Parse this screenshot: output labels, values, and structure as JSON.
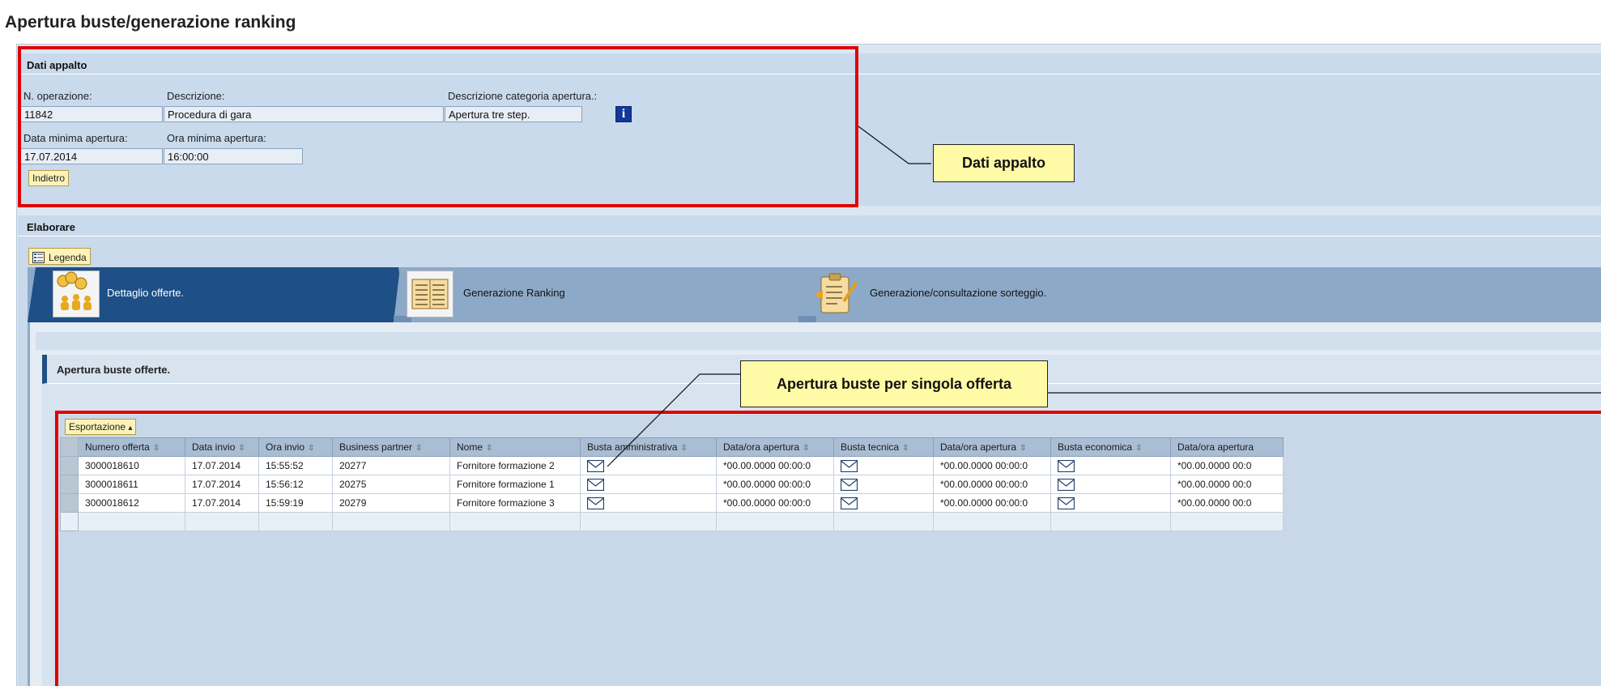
{
  "page_title": "Apertura buste/generazione ranking",
  "dati_appalto": {
    "header": "Dati appalto",
    "labels": {
      "n_operazione": "N. operazione:",
      "descrizione": "Descrizione:",
      "descrizione_categoria": "Descrizione categoria apertura.:",
      "data_minima": "Data minima apertura:",
      "ora_minima": "Ora minima apertura:"
    },
    "values": {
      "n_operazione": "11842",
      "descrizione": "Procedura di gara",
      "descrizione_categoria": "Apertura tre step.",
      "data_minima": "17.07.2014",
      "ora_minima": "16:00:00"
    },
    "info_icon": "i",
    "back_button": "Indietro"
  },
  "callouts": {
    "dati_appalto": "Dati appalto",
    "apertura_singola": "Apertura buste per singola offerta"
  },
  "elaborare": {
    "header": "Elaborare",
    "legend_button": "Legenda",
    "tabs": [
      {
        "label": "Dettaglio offerte.",
        "icon": "coins-people-icon",
        "active": true
      },
      {
        "label": "Generazione Ranking",
        "icon": "ranking-table-icon",
        "active": false
      },
      {
        "label": "Generazione/consultazione sorteggio.",
        "icon": "clipboard-pencil-icon",
        "active": false
      }
    ],
    "panel_title": "Apertura buste offerte.",
    "export_button": "Esportazione",
    "export_arrow": "▴",
    "sort_icon": "⇳",
    "table": {
      "columns": [
        "Numero offerta",
        "Data invio",
        "Ora invio",
        "Business partner",
        "Nome",
        "Busta amministrativa",
        "Data/ora apertura",
        "Busta tecnica",
        "Data/ora apertura",
        "Busta economica",
        "Data/ora apertura"
      ],
      "rows": [
        [
          "3000018610",
          "17.07.2014",
          "15:55:52",
          "20277",
          "Fornitore formazione 2",
          "",
          "*00.00.0000 00:00:0",
          "",
          "*00.00.0000 00:00:0",
          "",
          "*00.00.0000 00:0"
        ],
        [
          "3000018611",
          "17.07.2014",
          "15:56:12",
          "20275",
          "Fornitore formazione 1",
          "",
          "*00.00.0000 00:00:0",
          "",
          "*00.00.0000 00:00:0",
          "",
          "*00.00.0000 00:0"
        ],
        [
          "3000018612",
          "17.07.2014",
          "15:59:19",
          "20279",
          "Fornitore formazione 3",
          "",
          "*00.00.0000 00:00:0",
          "",
          "*00.00.0000 00:00:0",
          "",
          "*00.00.0000 00:0"
        ]
      ]
    }
  },
  "colors": {
    "highlight_red": "#e10000",
    "callout_yellow": "#fffaa6",
    "active_tab": "#1e4f86",
    "panel_blue": "#c9daec",
    "button_yellow": "#fdf2b8"
  }
}
